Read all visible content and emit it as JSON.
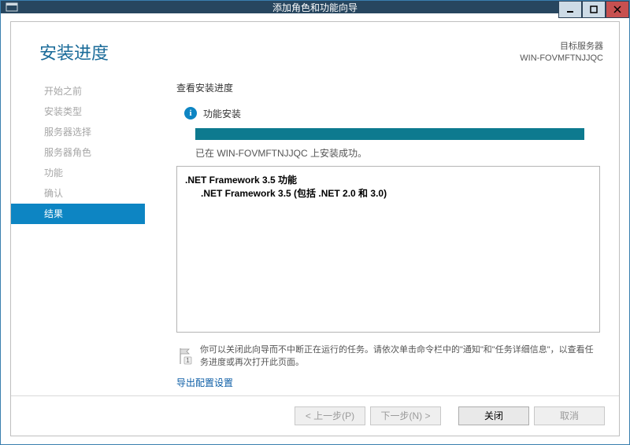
{
  "window": {
    "title": "添加角色和功能向导"
  },
  "header": {
    "title": "安装进度",
    "target_label": "目标服务器",
    "target_name": "WIN-FOVMFTNJJQC"
  },
  "sidebar": {
    "items": [
      {
        "label": "开始之前",
        "selected": false
      },
      {
        "label": "安装类型",
        "selected": false
      },
      {
        "label": "服务器选择",
        "selected": false
      },
      {
        "label": "服务器角色",
        "selected": false
      },
      {
        "label": "功能",
        "selected": false
      },
      {
        "label": "确认",
        "selected": false
      },
      {
        "label": "结果",
        "selected": true
      }
    ]
  },
  "main": {
    "section_label": "查看安装进度",
    "status": "功能安装",
    "sub_status": "已在 WIN-FOVMFTNJJQC 上安装成功。",
    "features": {
      "line1": ".NET Framework 3.5 功能",
      "line2": ".NET Framework 3.5 (包括 .NET 2.0 和 3.0)"
    },
    "note": "你可以关闭此向导而不中断正在运行的任务。请依次单击命令栏中的\"通知\"和\"任务详细信息\"，以查看任务进度或再次打开此页面。",
    "export_link": "导出配置设置"
  },
  "footer": {
    "prev": "< 上一步(P)",
    "next": "下一步(N) >",
    "close": "关闭",
    "cancel": "取消"
  }
}
